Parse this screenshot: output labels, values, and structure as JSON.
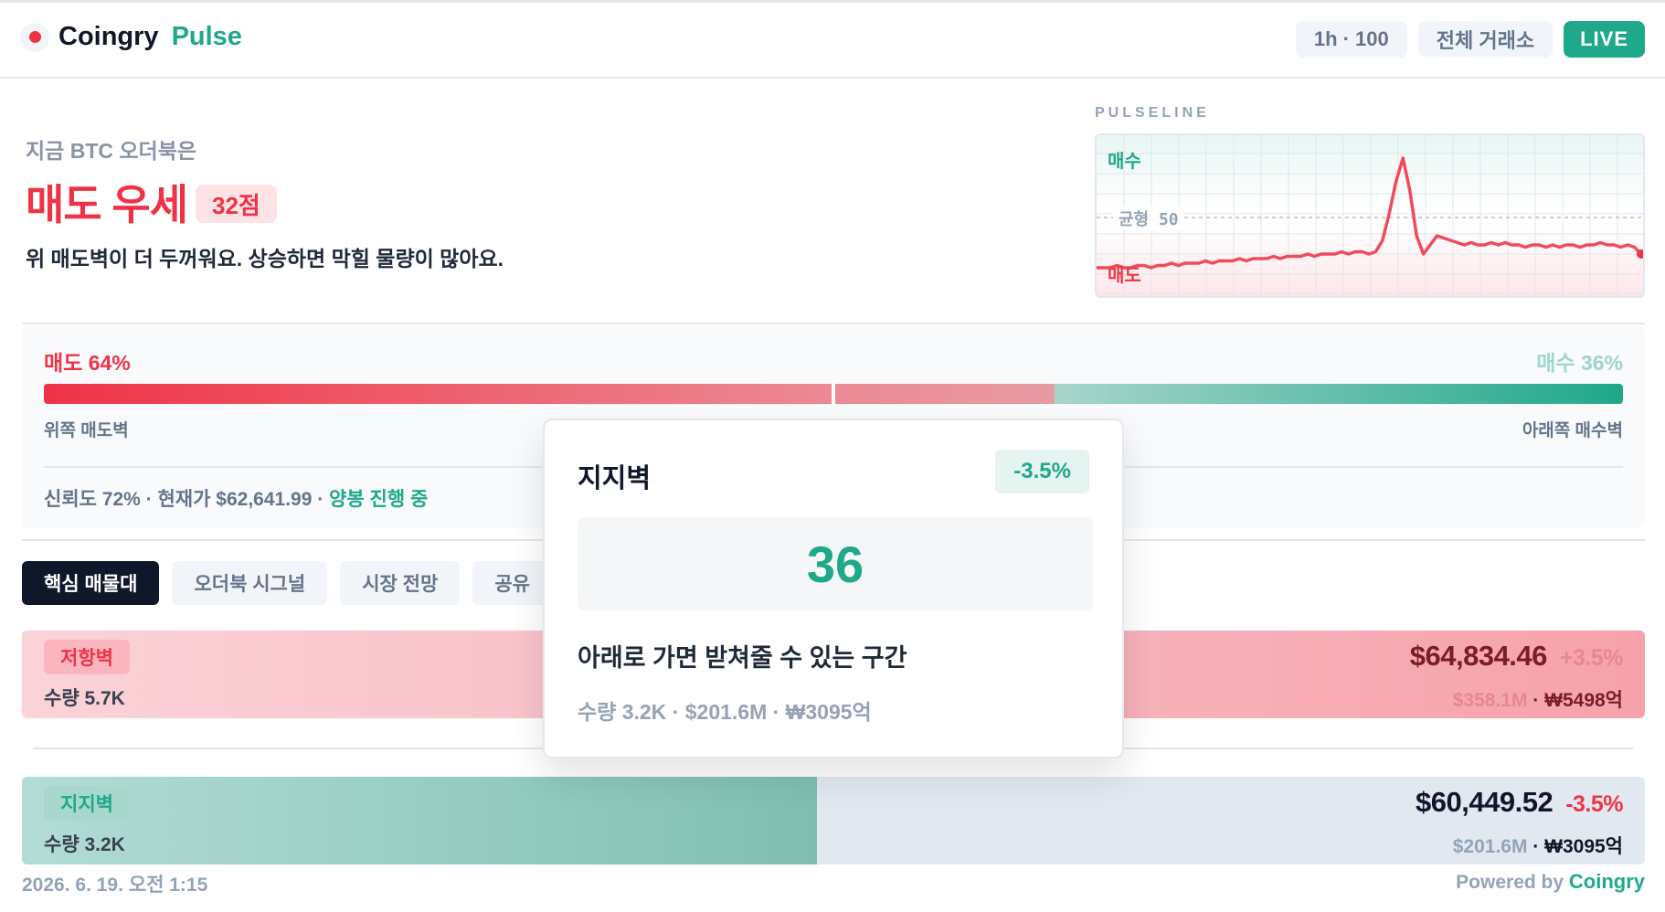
{
  "header": {
    "brand_name": "Coingry",
    "brand_sub": "Pulse",
    "interval_chip": "1h · 100",
    "exchange_chip": "전체 거래소",
    "live_chip": "LIVE"
  },
  "hero": {
    "kicker": "지금 BTC 오더북은",
    "title": "매도 우세",
    "score": "32점",
    "description": "위 매도벽이 더 두꺼워요. 상승하면 막힐 물량이 많아요."
  },
  "pulseline": {
    "label": "PULSELINE",
    "buy_label": "매수",
    "sell_label": "매도",
    "mid_label": "균형 50",
    "colors": {
      "line": "#ef4b5c",
      "buy": "#1fa88a",
      "sell": "#ef3346"
    },
    "series": [
      28,
      28,
      28,
      29,
      28,
      28,
      29,
      29,
      28,
      29,
      29,
      30,
      29,
      30,
      30,
      30,
      31,
      30,
      31,
      31,
      31,
      32,
      31,
      32,
      32,
      32,
      33,
      32,
      33,
      33,
      33,
      34,
      33,
      34,
      34,
      34,
      35,
      34,
      35,
      35,
      34,
      35,
      40,
      52,
      66,
      76,
      62,
      42,
      34,
      38,
      42,
      41,
      40,
      39,
      38,
      39,
      38,
      38,
      39,
      38,
      39,
      38,
      38,
      37,
      38,
      38,
      37,
      38,
      37,
      38,
      38,
      37,
      38,
      38,
      39,
      38,
      38,
      37,
      38,
      37,
      34
    ]
  },
  "balance": {
    "sell_label": "매도 64%",
    "buy_label": "매수 36%",
    "sell_pct": 64,
    "buy_pct": 36,
    "marker_pct": 50,
    "left_caption": "위쪽 매도벽",
    "right_caption": "아래쪽 매수벽",
    "meta_text": "신뢰도 72% · 현재가 $62,641.99 · ",
    "meta_trend": "양봉 진행 중"
  },
  "tabs": [
    {
      "label": "핵심 매물대",
      "active": true
    },
    {
      "label": "오더북 시그널",
      "active": false
    },
    {
      "label": "시장 전망",
      "active": false
    },
    {
      "label": "공유",
      "active": false
    }
  ],
  "resistance": {
    "badge": "저항벽",
    "qty": "수량 5.7K",
    "price": "$64,834.46",
    "pct": "+3.5%",
    "usd": "$358.1M",
    "sep": " · ",
    "krw": "₩5498억"
  },
  "support": {
    "badge": "지지벽",
    "qty": "수량 3.2K",
    "price": "$60,449.52",
    "pct": "-3.5%",
    "usd": "$201.6M",
    "sep": " · ",
    "krw": "₩3095억",
    "fill_pct": 49
  },
  "footer": {
    "date": "2026. 6. 19. 오전 1:15",
    "powered": "Powered by ",
    "powered_brand": "Coingry"
  },
  "tooltip": {
    "title": "지지벽",
    "pct": "-3.5%",
    "score": "36",
    "description": "아래로 가면 받쳐줄 수 있는 구간",
    "sub": "수량 3.2K · $201.6M · ₩3095억"
  }
}
